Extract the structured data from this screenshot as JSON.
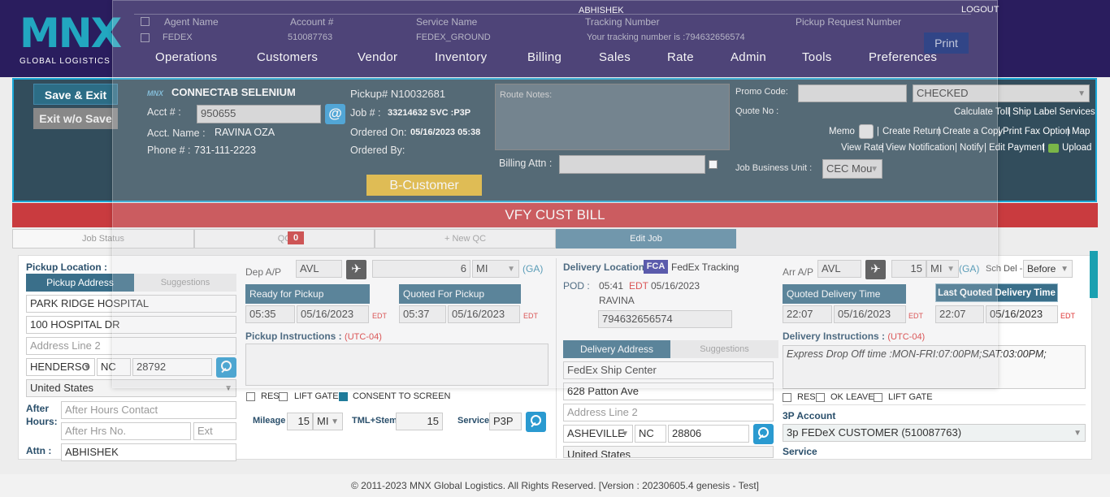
{
  "header": {
    "logo_main": "MNX",
    "logo_sub": "GLOBAL LOGISTICS",
    "user": "ABHISHEK",
    "logout": "LOGOUT",
    "nav": [
      "Operations",
      "Customers",
      "Vendor",
      "Inventory",
      "Billing",
      "Sales",
      "Rate",
      "Admin",
      "Tools",
      "Preferences"
    ]
  },
  "overlay": {
    "columns": [
      "Agent Name",
      "Account #",
      "Service Name",
      "Tracking Number",
      "Pickup Request Number"
    ],
    "row": {
      "agent": "FEDEX",
      "account": "510087763",
      "service": "FEDEX_GROUND",
      "tracking": "Your tracking number is :794632656574"
    },
    "print": "Print"
  },
  "job": {
    "save_exit": "Save & Exit",
    "exit_no_save": "Exit w/o Save",
    "brand_prefix": "MNX",
    "customer_name": "CONNECTAB SELENIUM",
    "acct_label": "Acct # :",
    "acct_value": "950655",
    "acct_name_label": "Acct. Name :",
    "acct_name": "RAVINA OZA",
    "phone_label": "Phone # :",
    "phone": "731-111-2223",
    "pickup_no": "Pickup# N10032681",
    "job_label": "Job # :",
    "job_value": "33214632 SVC :P3P",
    "ordered_on_label": "Ordered On:",
    "ordered_on": "05/16/2023 05:38",
    "ordered_by_label": "Ordered By:",
    "route_notes": "Route Notes:",
    "billing_attn": "Billing Attn :",
    "b_customer": "B-Customer",
    "promo_label": "Promo Code:",
    "status_select": "CHECKED",
    "quote_label": "Quote No :",
    "links_row1": [
      "Calculate Toll",
      "Ship Label Services"
    ],
    "memo": "Memo",
    "links_row2": [
      "Create Return",
      "Create a Copy",
      "Print Fax Option",
      "Map"
    ],
    "links_row3": [
      "View Rate",
      "View Notification",
      "Notify",
      "Edit Payment",
      "Upload"
    ],
    "jbu_label": "Job Business Unit :",
    "jbu_value": "CEC Mou"
  },
  "banner": "VFY CUST BILL",
  "tabs": [
    {
      "label": "Job Status"
    },
    {
      "label": "QC",
      "badge": "0"
    },
    {
      "label": "+ New QC"
    },
    {
      "label": "Edit Job"
    }
  ],
  "pickup": {
    "title": "Pickup Location :",
    "addr_tab": "Pickup Address",
    "sugg_tab": "Suggestions",
    "name": "PARK RIDGE HOSPITAL",
    "addr1": "100 HOSPITAL DR",
    "addr2_ph": "Address Line 2",
    "city": "HENDERSO",
    "state": "NC",
    "zip": "28792",
    "country": "United States",
    "after_hours_label": "After Hours:",
    "after_contact_ph": "After Hours Contact",
    "after_no_ph": "After Hrs No.",
    "ext_ph": "Ext",
    "attn_label": "Attn :",
    "attn": "ABHISHEK"
  },
  "dep": {
    "label": "Dep A/P",
    "airport": "AVL",
    "distance": "6",
    "unit": "MI",
    "ga": "(GA)",
    "ready_label": "Ready for Pickup",
    "ready_time": "05:35",
    "ready_date": "05/16/2023",
    "tz": "EDT",
    "quoted_label": "Quoted For Pickup",
    "quoted_time": "05:37",
    "quoted_date": "05/16/2023",
    "instr_label": "Pickup Instructions :",
    "instr_tz": "(UTC-04)",
    "res": "RES",
    "lift_gate": "LIFT GATE",
    "consent": "CONSENT TO SCREEN",
    "mileage_label": "Mileage",
    "mileage": "15",
    "mileage_unit": "MI",
    "tml_label": "TML+Stem",
    "tml": "15",
    "service_label": "Service",
    "service": "P3P"
  },
  "delivery": {
    "title": "Delivery Location :",
    "fca": "FCA",
    "fedex_tracking": "FedEx Tracking",
    "pod_label": "POD :",
    "pod_time": "05:41",
    "pod_tz": "EDT",
    "pod_date": "05/16/2023",
    "pod_name": "RAVINA",
    "tracking": "794632656574",
    "addr_tab": "Delivery Address",
    "sugg_tab": "Suggestions",
    "name": "FedEx Ship Center",
    "addr1": "628 Patton Ave",
    "addr2_ph": "Address Line 2",
    "city": "ASHEVILLE",
    "state": "NC",
    "zip": "28806",
    "country": "United States"
  },
  "arr": {
    "label": "Arr A/P",
    "airport": "AVL",
    "distance": "15",
    "unit": "MI",
    "ga": "(GA)",
    "sch_label": "Sch Del -",
    "sch_value": "Before",
    "quoted_label": "Quoted Delivery Time",
    "quoted_time": "22:07",
    "quoted_date": "05/16/2023",
    "last_label": "Last Quoted Delivery Time",
    "last_time": "22:07",
    "last_date": "05/16/2023",
    "tz": "EDT",
    "instr_label": "Delivery Instructions :",
    "instr_tz": "(UTC-04)",
    "instr": "Express Drop Off time :MON-FRI:07:00PM;SAT:03:00PM;",
    "res": "RES",
    "ok_leave": "OK LEAVE",
    "lift_gate": "LIFT GATE",
    "acct3p_label": "3P Account",
    "acct3p": "3p FEDeX CUSTOMER (510087763)",
    "service_label": "Service"
  },
  "footer": "© 2011-2023 MNX Global Logistics. All Rights Reserved. [Version : 20230605.4 genesis - Test]"
}
